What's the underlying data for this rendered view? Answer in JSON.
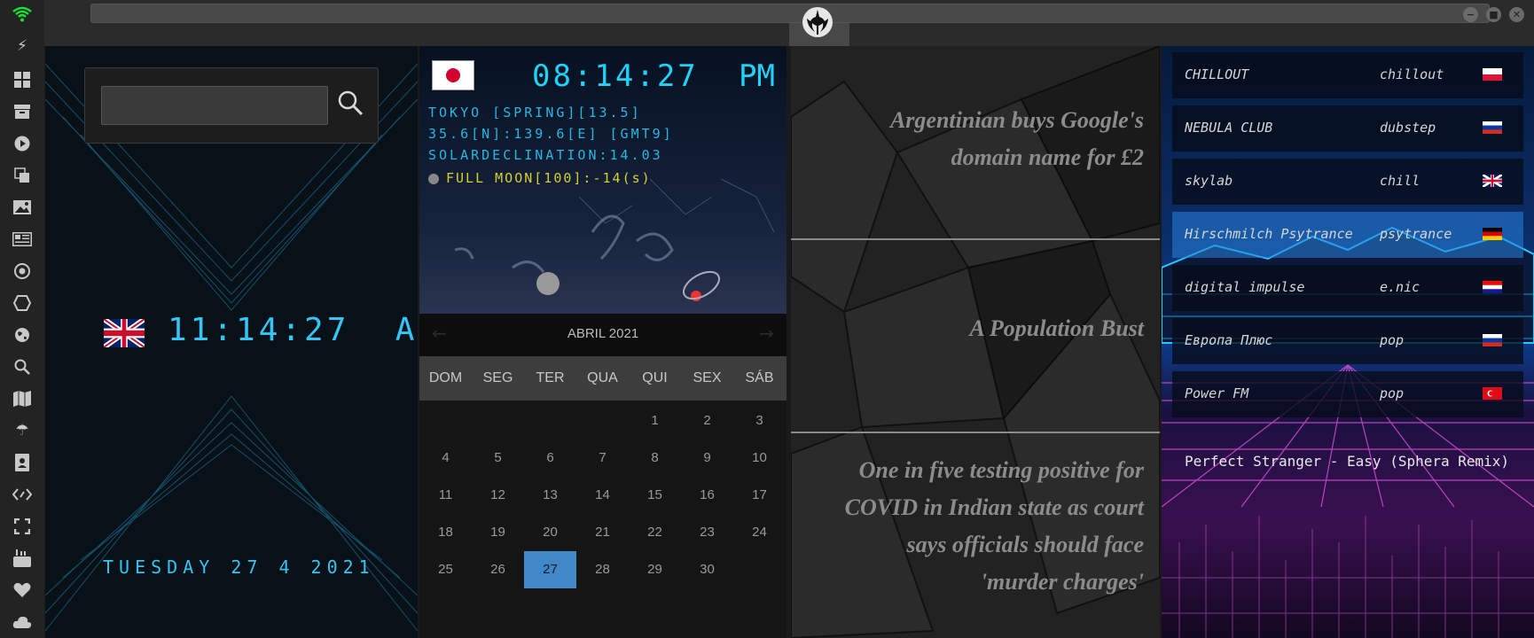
{
  "header": {
    "logo": "rebel-alliance-icon",
    "window_buttons": [
      "minimize",
      "maximize",
      "close"
    ]
  },
  "sidebar": {
    "icons": [
      "wifi-icon",
      "lightning-icon",
      "windows-icon",
      "archive-icon",
      "play-icon",
      "translate-icon",
      "image-icon",
      "news-icon",
      "aperture-icon",
      "hexagon-icon",
      "globe-icon",
      "search-icon",
      "map-icon",
      "umbrella-icon",
      "contacts-icon",
      "code-icon",
      "fullscreen-icon",
      "youtube-icon",
      "heart-icon",
      "cloud-icon"
    ]
  },
  "search": {
    "value": "",
    "placeholder": ""
  },
  "clock_uk": {
    "time": "11:14:27",
    "ampm": "AM",
    "date": "TUESDAY 27 4 2021"
  },
  "clock_tokyo": {
    "time": "08:14:27",
    "ampm": "PM",
    "line1": "TOKYO [SPRING][13.5]",
    "line2": "35.6[N]:139.6[E] [GMT9]",
    "line3": "SOLARDECLINATION:14.03",
    "moon": "FULL MOON[100]:-14",
    "moon_suffix": "(s)"
  },
  "calendar": {
    "title": "ABRIL 2021",
    "prev": "←",
    "next": "→",
    "weekdays": [
      "DOM",
      "SEG",
      "TER",
      "QUA",
      "QUI",
      "SEX",
      "SÁB"
    ],
    "weeks": [
      [
        "",
        "",
        "",
        "",
        "1",
        "2",
        "3"
      ],
      [
        "4",
        "5",
        "6",
        "7",
        "8",
        "9",
        "10"
      ],
      [
        "11",
        "12",
        "13",
        "14",
        "15",
        "16",
        "17"
      ],
      [
        "18",
        "19",
        "20",
        "21",
        "22",
        "23",
        "24"
      ],
      [
        "25",
        "26",
        "27",
        "28",
        "29",
        "30",
        ""
      ]
    ],
    "today": "27"
  },
  "news": [
    {
      "headline_1": "Argentinian buys Google's",
      "headline_2": "domain name for £2"
    },
    {
      "headline_1": "A Population Bust"
    },
    {
      "headline_1": "One in five testing positive for",
      "headline_2": "COVID in Indian state as court",
      "headline_3": "says officials should face",
      "headline_4": "'murder charges'"
    }
  ],
  "radio": {
    "stations": [
      {
        "name": "CHILLOUT",
        "genre": "chillout",
        "flag": "poland"
      },
      {
        "name": "NEBULA CLUB",
        "genre": "dubstep",
        "flag": "russia"
      },
      {
        "name": "skylab",
        "genre": "chill",
        "flag": "uk"
      },
      {
        "name": "Hirschmilch Psytrance",
        "genre": "psytrance",
        "flag": "germany"
      },
      {
        "name": "digital impulse",
        "genre": "e.nic",
        "flag": "croatia"
      },
      {
        "name": "Европа Плюс",
        "genre": "pop",
        "flag": "russia"
      },
      {
        "name": "Power FM",
        "genre": "pop",
        "flag": "turkey"
      }
    ],
    "active_index": 3,
    "now_playing": "Perfect Stranger - Easy (Sphera Remix)"
  },
  "colors": {
    "accent": "#33c5f5",
    "moon_text": "#d6d02e",
    "today": "#4188c9",
    "sidebar": "#232323"
  }
}
